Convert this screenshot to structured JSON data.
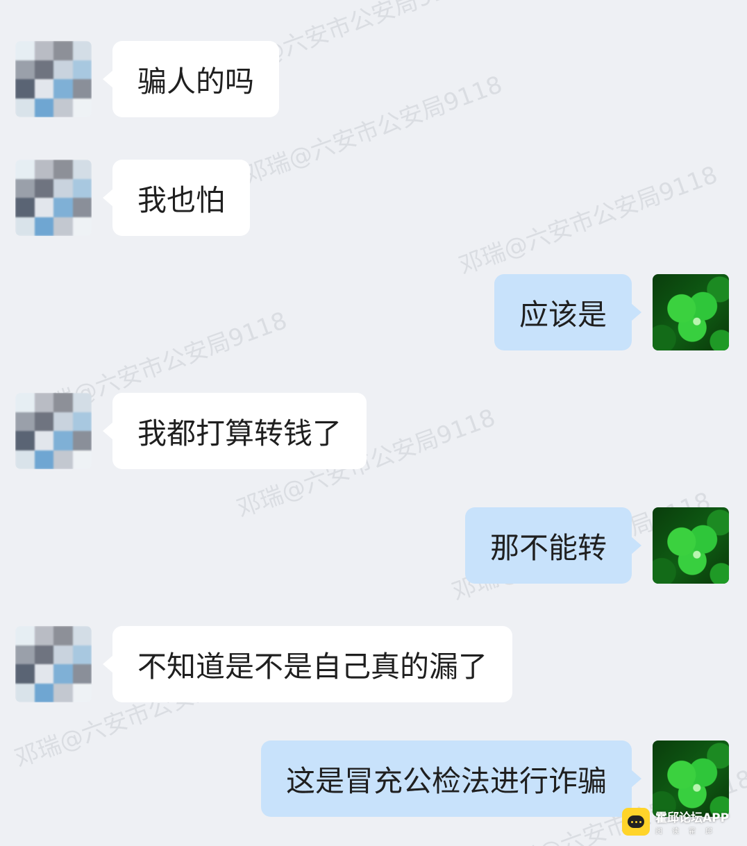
{
  "watermark": "邓瑞@六安市公安局9118",
  "colors": {
    "background": "#eef0f4",
    "incoming_bubble": "#ffffff",
    "outgoing_bubble": "#c8e2fb",
    "app_logo": "#ffd42a"
  },
  "messages": [
    {
      "side": "left",
      "avatar": "pixelated-avatar",
      "text": "骗人的吗"
    },
    {
      "side": "left",
      "avatar": "pixelated-avatar",
      "text": "我也怕"
    },
    {
      "side": "right",
      "avatar": "green-clover-avatar",
      "text": "应该是"
    },
    {
      "side": "left",
      "avatar": "pixelated-avatar",
      "text": "我都打算转钱了"
    },
    {
      "side": "right",
      "avatar": "green-clover-avatar",
      "text": "那不能转"
    },
    {
      "side": "left",
      "avatar": "pixelated-avatar",
      "text": "不知道是不是自己真的漏了"
    },
    {
      "side": "right",
      "avatar": "green-clover-avatar",
      "text": "这是冒充公检法进行诈骗"
    }
  ],
  "app_badge": {
    "name": "霍邱论坛APP",
    "slogan": "阅读霍邱",
    "icon": "chat-bubble-icon"
  }
}
